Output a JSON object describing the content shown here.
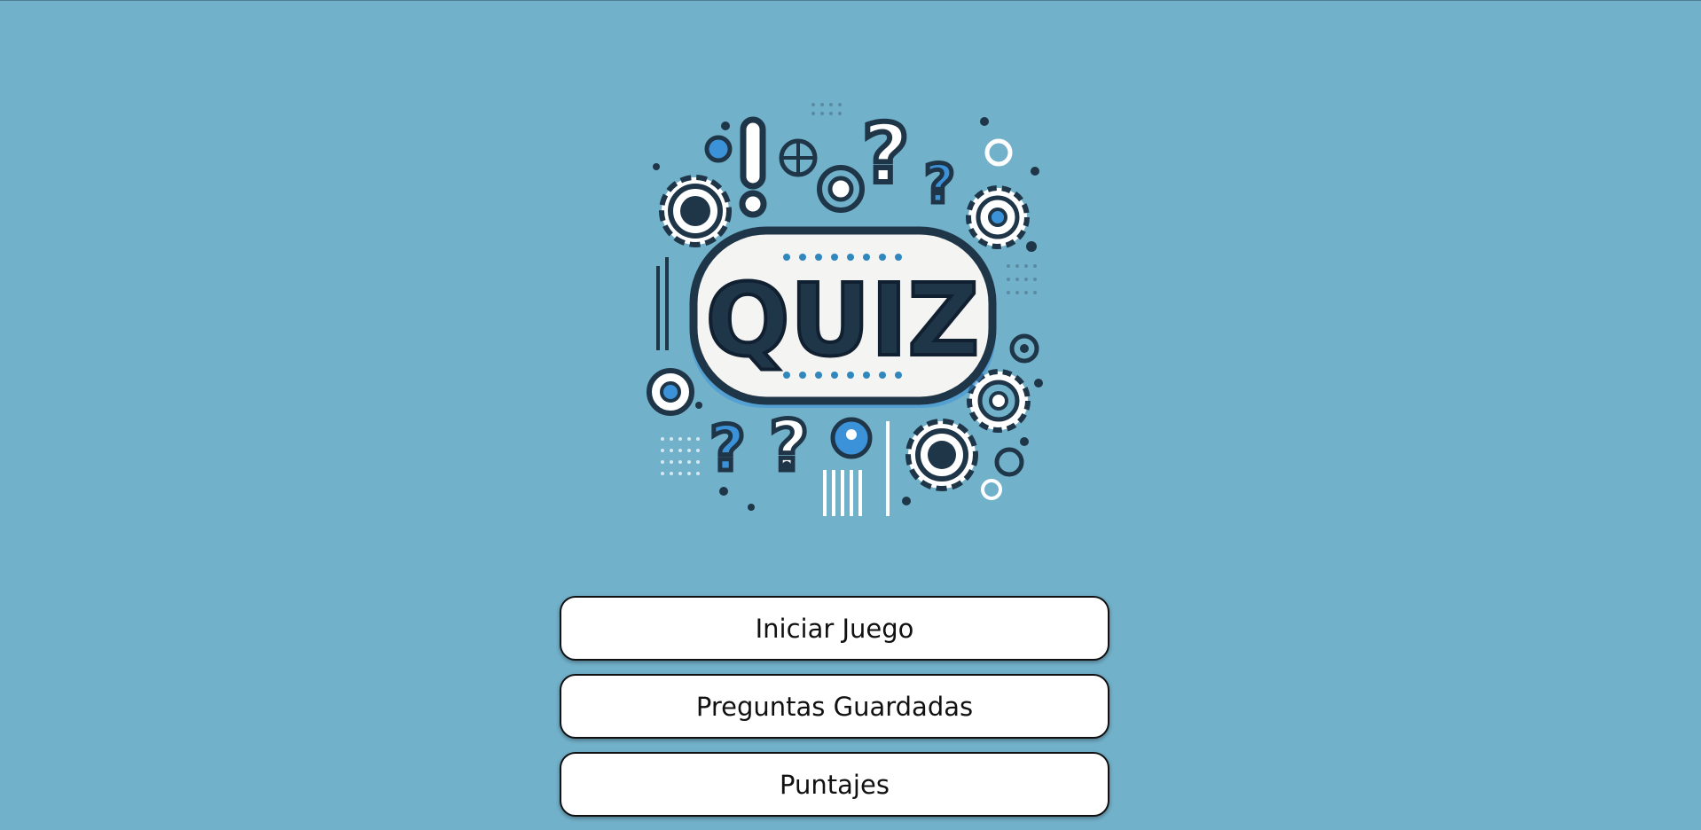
{
  "logo": {
    "text": "QUIZ",
    "icon": "quiz-logo"
  },
  "menu": {
    "items": [
      {
        "label": "Iniciar Juego"
      },
      {
        "label": "Preguntas Guardadas"
      },
      {
        "label": "Puntajes"
      }
    ]
  },
  "colors": {
    "background": "#72b1ca",
    "button_background": "#ffffff",
    "button_border": "#111111",
    "logo_dark": "#1f3548",
    "logo_accent": "#3c92d8"
  }
}
